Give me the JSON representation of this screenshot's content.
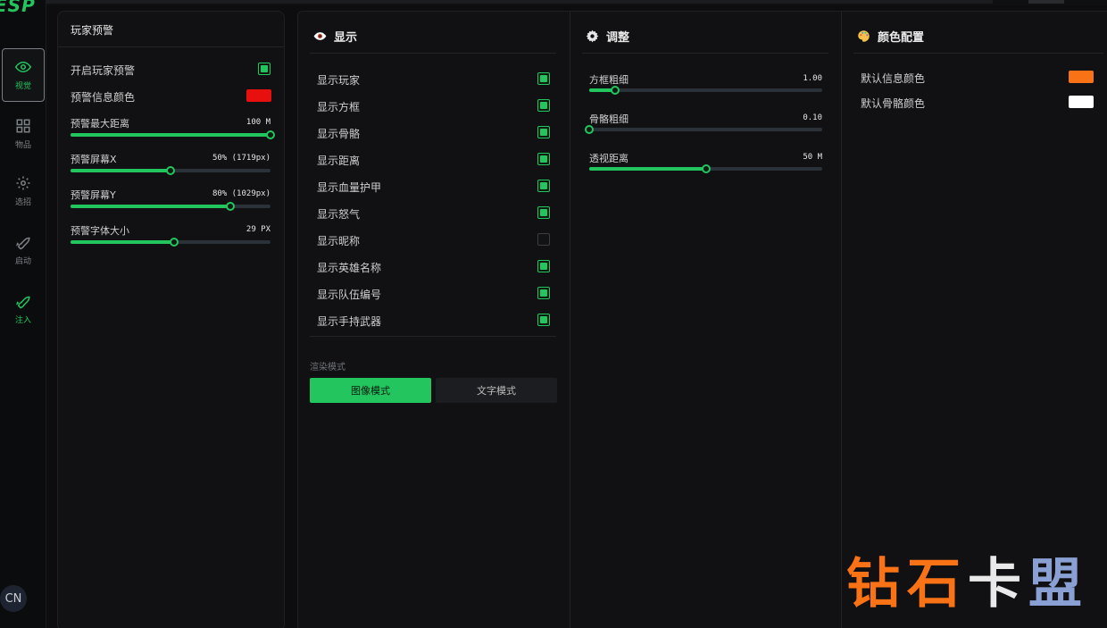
{
  "app": {
    "logo": "ESP",
    "lang": "CN"
  },
  "nav": [
    {
      "label": "视觉",
      "icon": "eye-icon",
      "active": true
    },
    {
      "label": "物品",
      "icon": "grid-icon"
    },
    {
      "label": "选招",
      "icon": "gear-icon"
    },
    {
      "label": "启动",
      "icon": "rocket-icon"
    },
    {
      "label": "注入",
      "icon": "rocket-icon"
    }
  ],
  "warning": {
    "title": "玩家预警",
    "enable_label": "开启玩家预警",
    "enable_checked": true,
    "info_color_label": "预警信息颜色",
    "info_color": "#e8100f",
    "sliders": [
      {
        "label": "预警最大距离",
        "value": "100 M",
        "fraction": 1.0
      },
      {
        "label": "预警屏幕X",
        "value": "50% (1719px)",
        "fraction": 0.5
      },
      {
        "label": "预警屏幕Y",
        "value": "80% (1029px)",
        "fraction": 0.8
      },
      {
        "label": "预警字体大小",
        "value": "29 PX",
        "fraction": 0.52
      }
    ]
  },
  "display": {
    "title": "显示",
    "icon": "eye-icon",
    "items": [
      {
        "label": "显示玩家",
        "checked": true
      },
      {
        "label": "显示方框",
        "checked": true
      },
      {
        "label": "显示骨骼",
        "checked": true
      },
      {
        "label": "显示距离",
        "checked": true
      },
      {
        "label": "显示血量护甲",
        "checked": true
      },
      {
        "label": "显示怒气",
        "checked": true
      },
      {
        "label": "显示昵称",
        "checked": false
      },
      {
        "label": "显示英雄名称",
        "checked": true
      },
      {
        "label": "显示队伍编号",
        "checked": true
      },
      {
        "label": "显示手持武器",
        "checked": true
      }
    ],
    "render_mode_label": "渲染模式",
    "modes": [
      {
        "label": "图像模式",
        "selected": true
      },
      {
        "label": "文字模式",
        "selected": false
      }
    ]
  },
  "adjust": {
    "title": "调整",
    "icon": "gear-icon",
    "sliders": [
      {
        "label": "方框粗细",
        "value": "1.00",
        "fraction": 0.11
      },
      {
        "label": "骨骼粗细",
        "value": "0.10",
        "fraction": 0.0
      },
      {
        "label": "透视距离",
        "value": "50 M",
        "fraction": 0.5
      }
    ]
  },
  "colors": {
    "title": "颜色配置",
    "icon": "palette-icon",
    "items": [
      {
        "label": "默认信息颜色",
        "color": "#f97316"
      },
      {
        "label": "默认骨骼颜色",
        "color": "#ffffff"
      }
    ]
  },
  "watermark": [
    "钻",
    "石",
    "卡",
    "盟"
  ]
}
